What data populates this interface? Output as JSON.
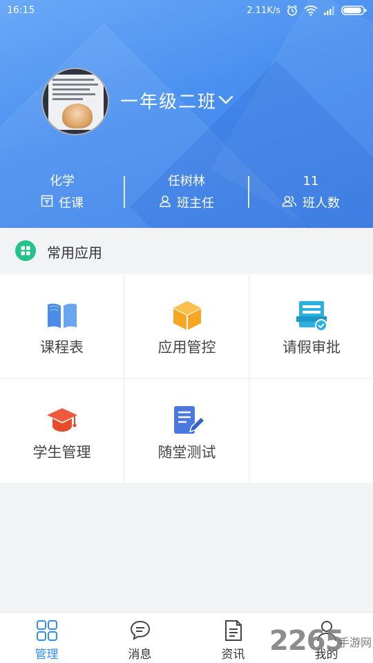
{
  "status_bar": {
    "time": "16:15",
    "speed": "2.11K/s",
    "icons": [
      "alarm-icon",
      "wifi-icon",
      "signal-icon",
      "battery-icon"
    ]
  },
  "header": {
    "class_name": "一年级二班",
    "stats": [
      {
        "value": "化学",
        "label": "任课",
        "icon": "course-icon"
      },
      {
        "value": "任树林",
        "label": "班主任",
        "icon": "person-icon"
      },
      {
        "value": "11",
        "label": "班人数",
        "icon": "people-icon"
      }
    ]
  },
  "section": {
    "title": "常用应用"
  },
  "apps": [
    {
      "label": "课程表",
      "icon": "book-icon",
      "color": "#4a8de8"
    },
    {
      "label": "应用管控",
      "icon": "box-icon",
      "color": "#f5a623"
    },
    {
      "label": "请假审批",
      "icon": "approval-icon",
      "color": "#2bb0e0"
    },
    {
      "label": "学生管理",
      "icon": "graduation-cap-icon",
      "color": "#f05a3c"
    },
    {
      "label": "随堂测试",
      "icon": "edit-doc-icon",
      "color": "#4a78e0"
    }
  ],
  "bottom_nav": [
    {
      "label": "管理",
      "icon": "grid-icon",
      "active": true
    },
    {
      "label": "消息",
      "icon": "chat-icon",
      "active": false
    },
    {
      "label": "资讯",
      "icon": "document-icon",
      "active": false
    },
    {
      "label": "我的",
      "icon": "user-icon",
      "active": false
    }
  ],
  "colors": {
    "primary": "#2f8ef0",
    "header_gradient_start": "#6aa9f7",
    "header_gradient_end": "#3b7fe8",
    "section_icon": "#27c28a"
  },
  "watermark": {
    "number": "2265",
    "text": "手游网"
  }
}
